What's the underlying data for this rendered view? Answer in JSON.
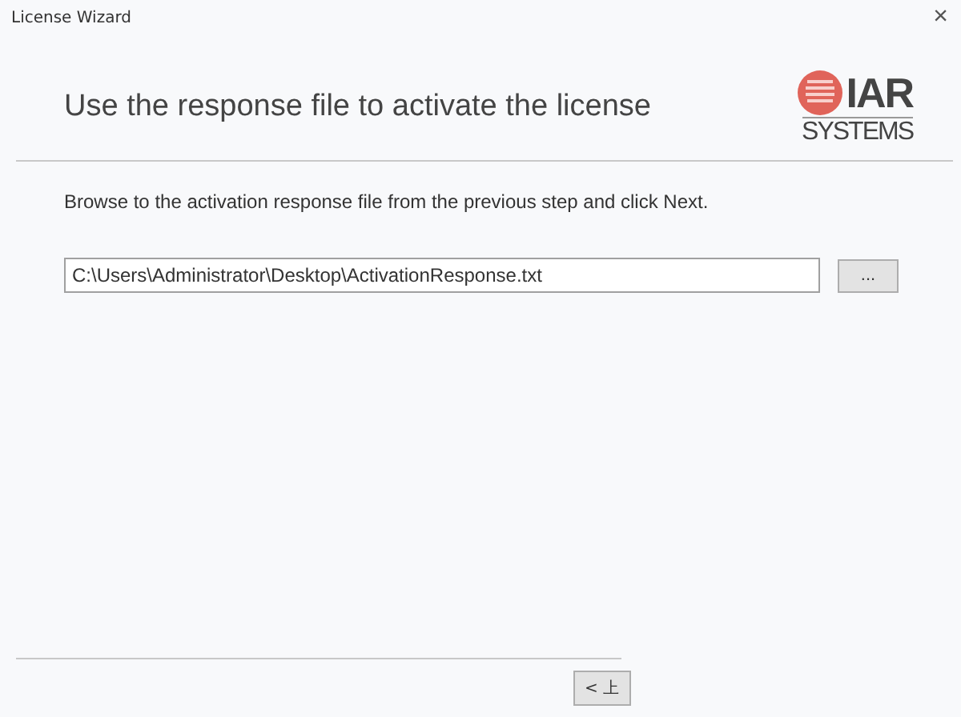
{
  "window": {
    "title": "License Wizard",
    "close": "×"
  },
  "header": {
    "title": "Use the response file to activate the license",
    "logo_top": "IAR",
    "logo_bottom": "SYSTEMS"
  },
  "instruction": "Browse to the activation response file from the previous step and click Next.",
  "file_field": {
    "value": "C:\\Users\\Administrator\\Desktop\\ActivationResponse.txt"
  },
  "browse_button": "...",
  "footer": {
    "back_button": "< 上"
  }
}
